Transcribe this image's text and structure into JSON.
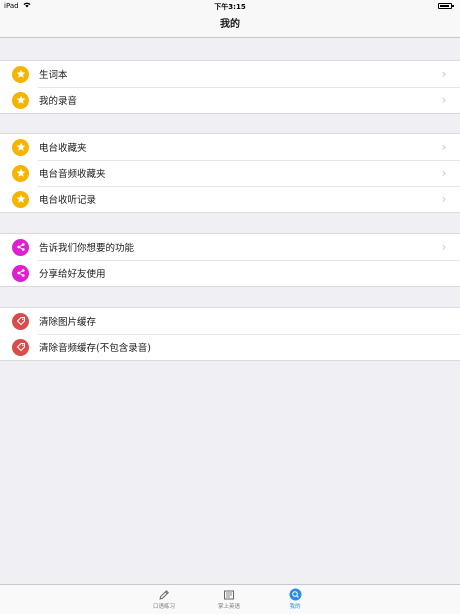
{
  "statusbar": {
    "device": "iPad",
    "time": "下午3:15"
  },
  "navbar": {
    "title": "我的"
  },
  "colors": {
    "star": "#f5b400",
    "share": "#e020d0",
    "clear": "#d94c4c",
    "active_tab": "#2a8ee8"
  },
  "groups": [
    {
      "items": [
        {
          "label": "生词本",
          "icon": "star-icon",
          "chevron": true
        },
        {
          "label": "我的录音",
          "icon": "star-icon",
          "chevron": true
        }
      ]
    },
    {
      "items": [
        {
          "label": "电台收藏夹",
          "icon": "star-icon",
          "chevron": true
        },
        {
          "label": "电台音频收藏夹",
          "icon": "star-icon",
          "chevron": true
        },
        {
          "label": "电台收听记录",
          "icon": "star-icon",
          "chevron": true
        }
      ]
    },
    {
      "items": [
        {
          "label": "告诉我们你想要的功能",
          "icon": "share-icon",
          "chevron": true
        },
        {
          "label": "分享给好友使用",
          "icon": "share-icon",
          "chevron": false
        }
      ]
    },
    {
      "items": [
        {
          "label": "清除图片缓存",
          "icon": "tag-icon",
          "chevron": false
        },
        {
          "label": "清除音频缓存(不包含录音)",
          "icon": "tag-icon",
          "chevron": false
        }
      ]
    }
  ],
  "tabbar": {
    "tabs": [
      {
        "label": "口语练习",
        "icon": "pencil-icon",
        "active": false
      },
      {
        "label": "掌上英语",
        "icon": "book-icon",
        "active": false
      },
      {
        "label": "我的",
        "icon": "search-icon",
        "active": true
      }
    ]
  }
}
